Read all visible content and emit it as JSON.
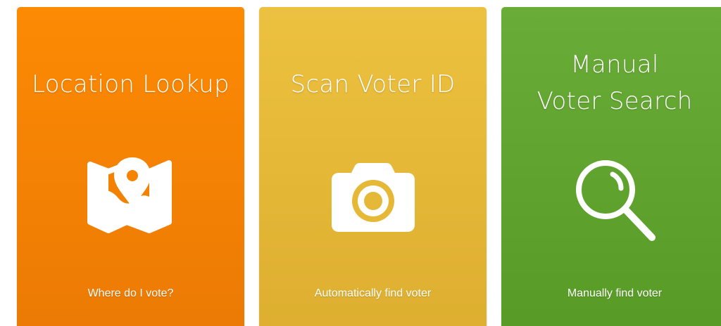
{
  "cards": [
    {
      "title": "Location Lookup",
      "subtitle": "Where do I vote?",
      "icon": "map-pin-icon",
      "color": "#f78303"
    },
    {
      "title": "Scan Voter ID",
      "subtitle": "Automatically find voter",
      "icon": "camera-icon",
      "color": "#e6b838"
    },
    {
      "title_lines": [
        "Manual",
        "Voter Search"
      ],
      "subtitle": "Manually find voter",
      "icon": "magnifier-icon",
      "color": "#61a32e"
    }
  ]
}
